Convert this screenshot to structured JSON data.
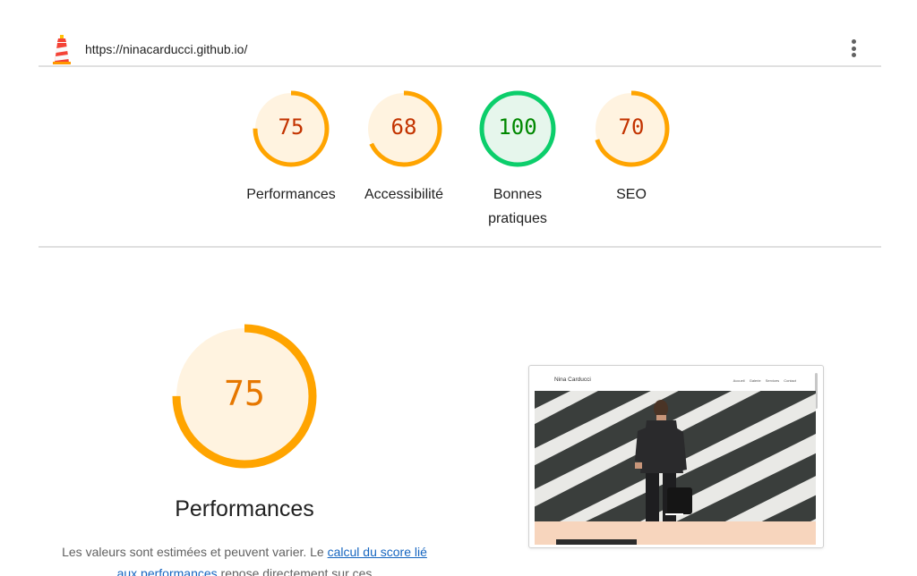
{
  "header": {
    "url": "https://ninacarducci.github.io/",
    "menu_icon": "more-vert-icon",
    "logo_icon": "lighthouse-icon"
  },
  "colors": {
    "average": "#ffa400",
    "average_text": "#c33300",
    "average_bg": "#fff3e0",
    "pass": "#0cce6b",
    "pass_text": "#008800",
    "pass_bg": "#e6f6ec",
    "link": "#1565c0"
  },
  "gauges": [
    {
      "score": "75",
      "label": "Performances",
      "status": "average"
    },
    {
      "score": "68",
      "label": "Accessibilité",
      "status": "average"
    },
    {
      "score": "100",
      "label": "Bonnes pratiques",
      "status": "pass"
    },
    {
      "score": "70",
      "label": "SEO",
      "status": "average"
    }
  ],
  "performance": {
    "score": "75",
    "title": "Performances",
    "desc_prefix": "Les valeurs sont estimées et peuvent varier. Le ",
    "link_text": "calcul du score lié aux performances",
    "desc_suffix": " repose directement sur ces"
  },
  "screenshot": {
    "brand": "Nina Carducci",
    "nav": [
      "Accueil",
      "Galerie",
      "Services",
      "Contact"
    ]
  }
}
